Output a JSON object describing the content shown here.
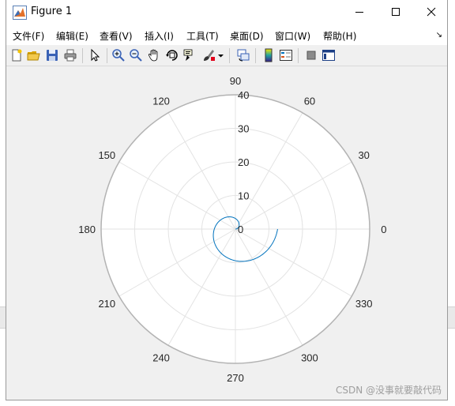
{
  "window": {
    "title": "Figure 1"
  },
  "menu": {
    "items": [
      "文件(F)",
      "编辑(E)",
      "查看(V)",
      "插入(I)",
      "工具(T)",
      "桌面(D)",
      "窗口(W)",
      "帮助(H)"
    ]
  },
  "toolbar": {
    "icons": [
      "new-figure-icon",
      "open-file-icon",
      "save-icon",
      "print-icon",
      "pointer-icon",
      "zoom-in-icon",
      "zoom-out-icon",
      "pan-icon",
      "rotate-3d-icon",
      "data-cursor-icon",
      "brush-icon",
      "link-plot-icon",
      "colorbar-icon",
      "legend-icon",
      "hide-plot-tools-icon",
      "show-plot-tools-icon"
    ]
  },
  "chart_data": {
    "type": "line",
    "coordinate_system": "polar",
    "angle_unit": "degrees",
    "theta_ticks": [
      0,
      30,
      60,
      90,
      120,
      150,
      180,
      210,
      240,
      270,
      300,
      330
    ],
    "theta_tick_labels": [
      "0",
      "30",
      "60",
      "90",
      "120",
      "150",
      "180",
      "210",
      "240",
      "270",
      "300",
      "330"
    ],
    "r_ticks": [
      0,
      10,
      20,
      30,
      40
    ],
    "r_tick_labels": [
      "0",
      "10",
      "20",
      "30",
      "40"
    ],
    "rlim": [
      0,
      40
    ],
    "r_label_angle": 90,
    "grid": true,
    "series": [
      {
        "color": "#0072bd",
        "equation": "r = 2*theta (theta in radians)",
        "theta_range_deg": [
          0,
          360
        ]
      }
    ],
    "title": "",
    "xlabel": "",
    "ylabel": ""
  },
  "watermark": "CSDN @没事就要敲代码"
}
